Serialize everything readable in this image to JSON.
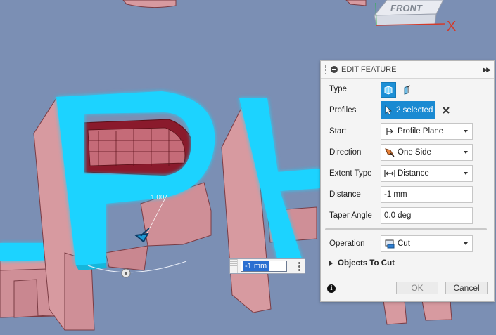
{
  "viewcube": {
    "face_label": "FRONT",
    "axis_label": "X"
  },
  "inline_input": {
    "value": "-1 mm"
  },
  "viewport": {
    "dimension_hint": "1.00"
  },
  "panel": {
    "title": "EDIT FEATURE",
    "collapse_icon": "minus-circle-icon",
    "expand_icon": "double-chevron-right-icon",
    "rows": {
      "type": {
        "label": "Type"
      },
      "profiles": {
        "label": "Profiles",
        "value": "2 selected"
      },
      "start": {
        "label": "Start",
        "value": "Profile Plane"
      },
      "direction": {
        "label": "Direction",
        "value": "One Side"
      },
      "extent_type": {
        "label": "Extent Type",
        "value": "Distance"
      },
      "distance": {
        "label": "Distance",
        "value": "-1 mm"
      },
      "taper_angle": {
        "label": "Taper Angle",
        "value": "0.0 deg"
      },
      "operation": {
        "label": "Operation",
        "value": "Cut"
      }
    },
    "objects_to_cut": "Objects To Cut",
    "ok_label": "OK",
    "cancel_label": "Cancel"
  },
  "colors": {
    "background": "#7b8fb4",
    "selection_highlight": "#1ed3ff",
    "body_fill": "#d79aa0",
    "accent": "#1a8ad2"
  }
}
